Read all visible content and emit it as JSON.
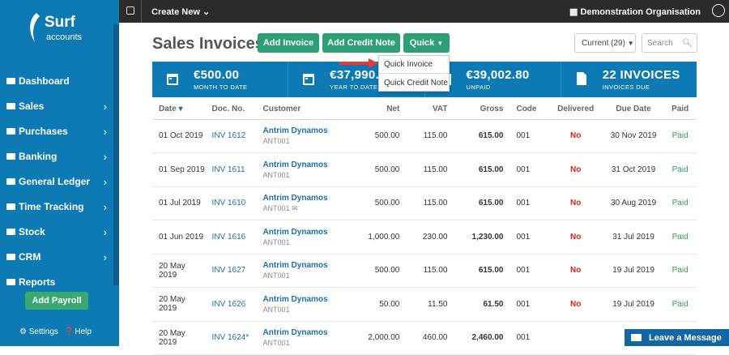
{
  "brand": {
    "name": "Surf",
    "sub": "accounts"
  },
  "topbar": {
    "create_label": "Create New",
    "org": "Demonstration Organisation"
  },
  "sidebar": {
    "items": [
      {
        "label": "Dashboard",
        "icon": "dashboard-icon",
        "chevron": false
      },
      {
        "label": "Sales",
        "icon": "briefcase-icon",
        "chevron": true
      },
      {
        "label": "Purchases",
        "icon": "list-icon",
        "chevron": true
      },
      {
        "label": "Banking",
        "icon": "bank-icon",
        "chevron": true
      },
      {
        "label": "General Ledger",
        "icon": "book-icon",
        "chevron": true
      },
      {
        "label": "Time Tracking",
        "icon": "clock-icon",
        "chevron": true
      },
      {
        "label": "Stock",
        "icon": "bar-chart-icon",
        "chevron": true
      },
      {
        "label": "CRM",
        "icon": "cloud-icon",
        "chevron": true
      },
      {
        "label": "Reports",
        "icon": "reports-icon",
        "chevron": false
      }
    ],
    "add_payroll": "Add Payroll",
    "settings": "Settings",
    "help": "Help"
  },
  "page": {
    "title": "Sales Invoices"
  },
  "actions": {
    "add_invoice": "Add Invoice",
    "add_credit_note": "Add Credit Note",
    "quick": "Quick"
  },
  "filter": {
    "current": "Current (29)",
    "search_placeholder": "Search"
  },
  "quick_menu": [
    "Quick Invoice",
    "Quick Credit Note"
  ],
  "stats": [
    {
      "value": "€500.00",
      "label": "MONTH TO DATE",
      "icon": "calendar-icon"
    },
    {
      "value": "€37,990.00",
      "label": "YEAR TO DATE",
      "icon": "calendar-icon"
    },
    {
      "value": "€39,002.80",
      "label": "UNPAID",
      "icon": "calendar-icon"
    },
    {
      "value": "22 INVOICES",
      "label": "INVOICES DUE",
      "icon": "document-icon"
    }
  ],
  "table": {
    "headers": [
      "Date",
      "Doc. No.",
      "Customer",
      "Net",
      "VAT",
      "Gross",
      "Code",
      "Delivered",
      "Due Date",
      "Paid"
    ],
    "rows": [
      {
        "date": "01 Oct 2019",
        "doc": "INV 1612",
        "customer": "Antrim Dynamos",
        "code_ref": "ANT001",
        "net": "500.00",
        "vat": "115.00",
        "gross": "615.00",
        "code": "001",
        "delivered": "No",
        "due": "30 Nov 2019",
        "paid": "Paid"
      },
      {
        "date": "01 Sep 2019",
        "doc": "INV 1611",
        "customer": "Antrim Dynamos",
        "code_ref": "ANT001",
        "net": "500.00",
        "vat": "115.00",
        "gross": "615.00",
        "code": "001",
        "delivered": "No",
        "due": "31 Oct 2019",
        "paid": "Paid"
      },
      {
        "date": "01 Jul 2019",
        "doc": "INV 1610",
        "customer": "Antrim Dynamos",
        "code_ref": "ANT001",
        "net": "500.00",
        "vat": "115.00",
        "gross": "615.00",
        "code": "001",
        "delivered": "No",
        "due": "30 Aug 2019",
        "paid": "Paid",
        "email": true
      },
      {
        "date": "01 Jun 2019",
        "doc": "INV 1616",
        "customer": "Antrim Dynamos",
        "code_ref": "ANT001",
        "net": "1,000.00",
        "vat": "230.00",
        "gross": "1,230.00",
        "code": "001",
        "delivered": "No",
        "due": "31 Jul 2019",
        "paid": "Paid"
      },
      {
        "date": "20 May 2019",
        "doc": "INV 1627",
        "customer": "Antrim Dynamos",
        "code_ref": "ANT001",
        "net": "500.00",
        "vat": "115.00",
        "gross": "615.00",
        "code": "001",
        "delivered": "No",
        "due": "19 Jul 2019",
        "paid": "Paid"
      },
      {
        "date": "20 May 2019",
        "doc": "INV 1626",
        "customer": "Antrim Dynamos",
        "code_ref": "ANT001",
        "net": "50.00",
        "vat": "11.50",
        "gross": "61.50",
        "code": "001",
        "delivered": "No",
        "due": "19 Jul 2019",
        "paid": "Paid"
      },
      {
        "date": "20 May 2019",
        "doc": "INV 1624*",
        "customer": "Antrim Dynamos",
        "code_ref": "ANT001",
        "net": "2,000.00",
        "vat": "460.00",
        "gross": "2,460.00",
        "code": "001",
        "delivered": "",
        "due": "",
        "paid": ""
      }
    ]
  },
  "chat": {
    "label": "Leave a Message"
  }
}
